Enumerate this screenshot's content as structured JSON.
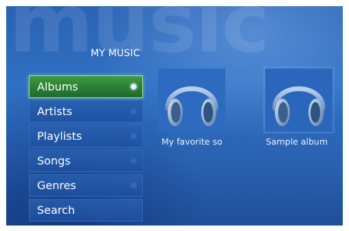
{
  "watermark": "music",
  "header": {
    "title": "MY MUSIC"
  },
  "menu": {
    "items": [
      {
        "label": "Albums",
        "selected": true
      },
      {
        "label": "Artists",
        "selected": false
      },
      {
        "label": "Playlists",
        "selected": false
      },
      {
        "label": "Songs",
        "selected": false
      },
      {
        "label": "Genres",
        "selected": false
      },
      {
        "label": "Search",
        "selected": false
      }
    ]
  },
  "albums": [
    {
      "caption": "My favorite so",
      "icon": "headphones-icon"
    },
    {
      "caption": "Sample album",
      "icon": "headphones-icon"
    }
  ],
  "colors": {
    "selected_item": "#2f8a38",
    "background": "#2b63b3",
    "text": "#ffffff"
  }
}
